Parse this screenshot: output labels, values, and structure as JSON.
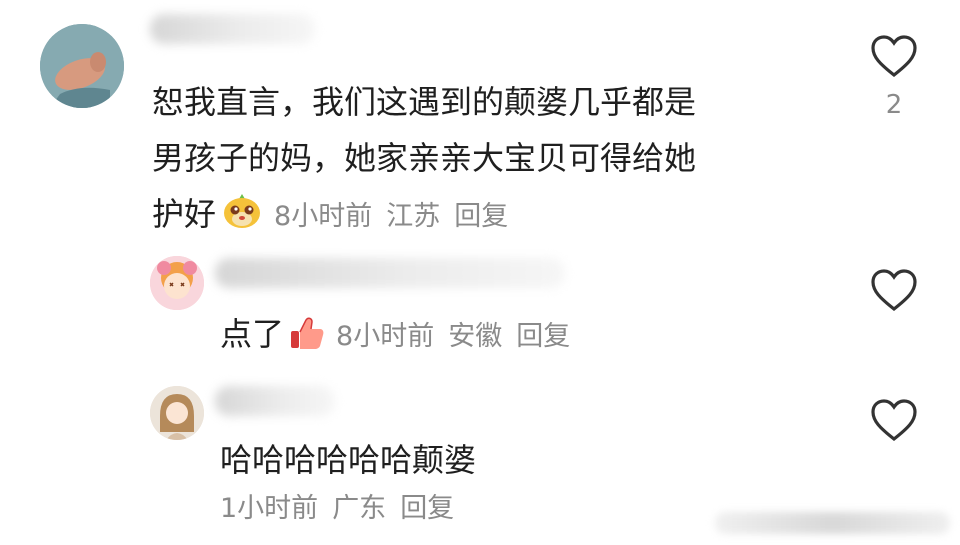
{
  "comments": [
    {
      "lines": [
        "恕我直言，我们这遇到的颠婆几乎都是",
        "男孩子的妈，她家亲亲大宝贝可得给她",
        "护好"
      ],
      "emoji": "pig-face-emoji",
      "time": "8小时前",
      "location": "江苏",
      "reply": "回复",
      "like_count": "2"
    },
    {
      "text": "点了",
      "emoji": "like-thumb-emoji",
      "time": "8小时前",
      "location": "安徽",
      "reply": "回复"
    },
    {
      "text": "哈哈哈哈哈哈颠婆",
      "time": "1小时前",
      "location": "广东",
      "reply": "回复"
    }
  ],
  "colors": {
    "meta": "#8a8a8a",
    "text": "#1f1f1f",
    "heart": "#333333"
  },
  "icons": [
    "heart-outline-icon"
  ]
}
